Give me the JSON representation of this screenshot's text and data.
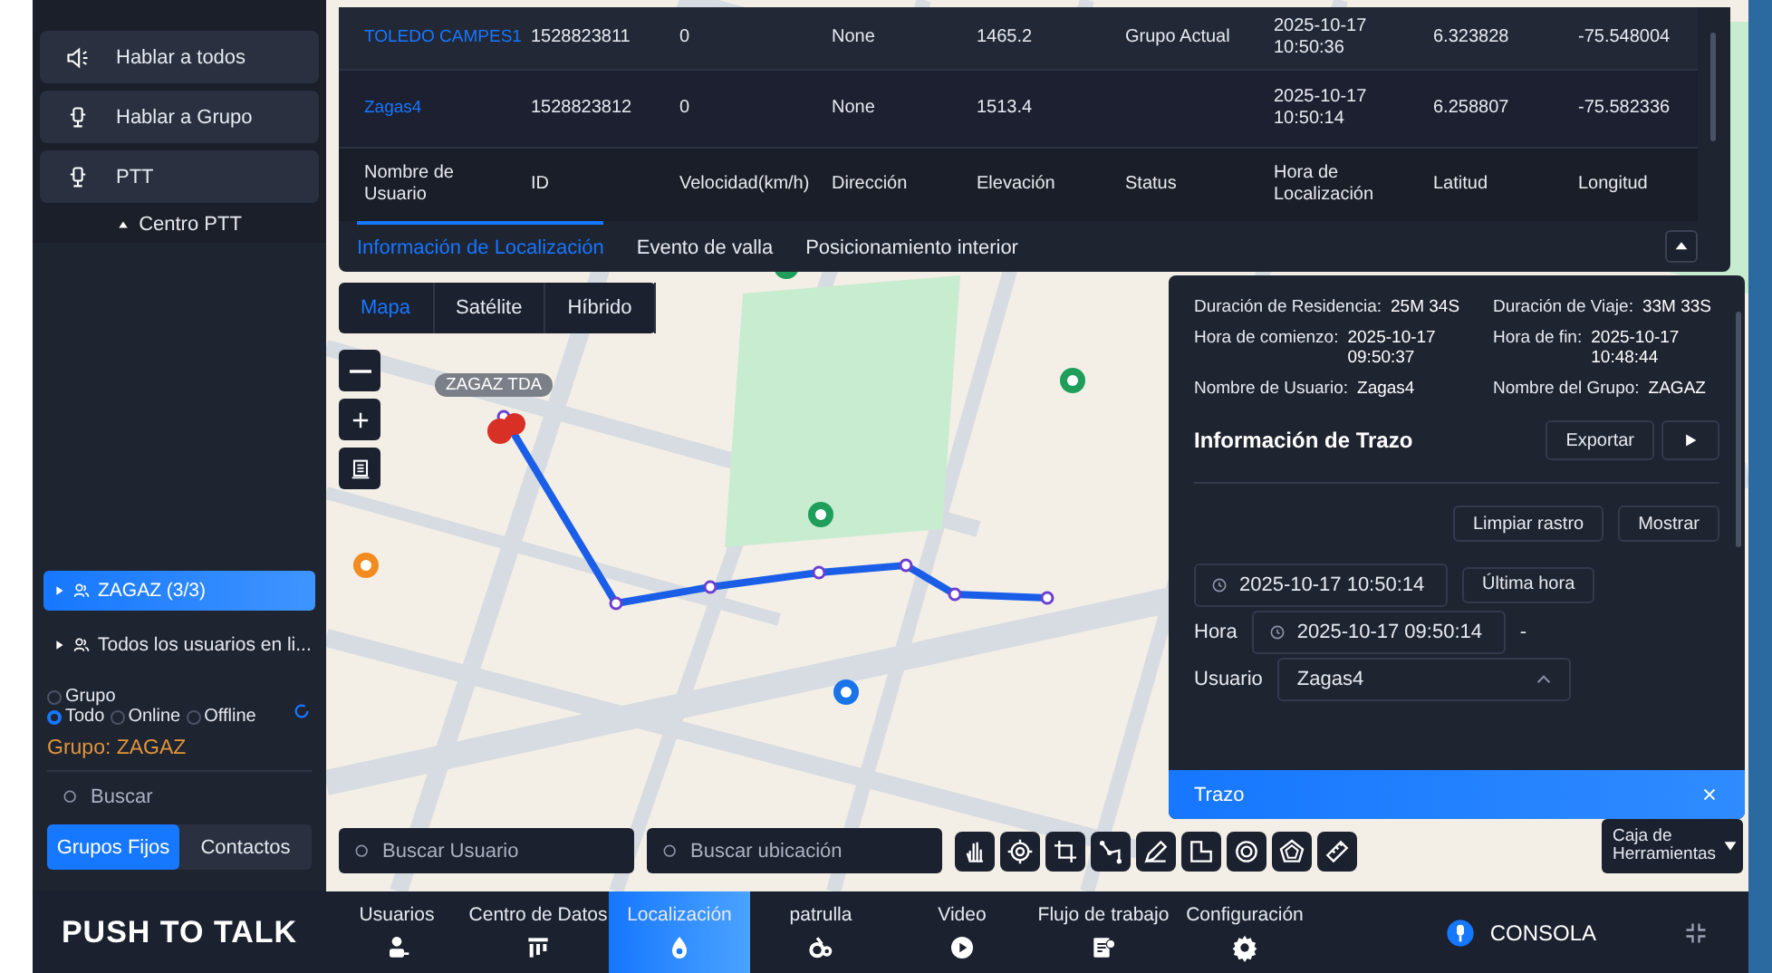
{
  "header": {
    "logo": "PUSH TO TALK",
    "nav": [
      {
        "label": "Usuarios",
        "selected": false
      },
      {
        "label": "Centro de Datos",
        "selected": false
      },
      {
        "label": "Localización",
        "selected": true
      },
      {
        "label": "patrulla",
        "selected": false
      },
      {
        "label": "Video",
        "selected": false
      },
      {
        "label": "Flujo de trabajo",
        "selected": false
      },
      {
        "label": "Configuración",
        "selected": false
      }
    ],
    "console": "CONSOLA"
  },
  "sidebar": {
    "ptt_buttons": [
      "Hablar a todos",
      "Hablar a Grupo",
      "PTT"
    ],
    "ptt_center": "Centro PTT",
    "tree": [
      {
        "label": "ZAGAZ (3/3)",
        "selected": true
      },
      {
        "label": "Todos los usuarios en li...",
        "selected": false
      }
    ],
    "filters": [
      {
        "label": "Grupo",
        "selected": false
      },
      {
        "label": "Todo",
        "selected": true
      },
      {
        "label": "Online",
        "selected": false
      },
      {
        "label": "Offline",
        "selected": false
      }
    ],
    "group_label": "Grupo: ZAGAZ",
    "search": {
      "placeholder": "Buscar"
    },
    "tabs": [
      {
        "label": "Grupos Fijos",
        "selected": true
      },
      {
        "label": "Contactos",
        "selected": false
      }
    ]
  },
  "location_panel": {
    "table_rows": [
      {
        "kind": "data",
        "cells": [
          "TOLEDO CAMPES1",
          "1528823811",
          "0",
          "None",
          "1465.2",
          "Grupo Actual",
          "2025-10-17 10:50:36",
          "6.323828",
          "-75.548004"
        ]
      },
      {
        "kind": "data",
        "cells": [
          "Zagas4",
          "1528823812",
          "0",
          "None",
          "1513.4",
          null,
          "2025-10-17 10:50:14",
          "6.258807",
          "-75.582336"
        ]
      },
      {
        "kind": "header",
        "cells": [
          "Nombre de Usuario",
          "ID",
          "Velocidad(km/h)",
          "Dirección",
          "Elevación",
          "Status",
          "Hora de Localización",
          "Latitud",
          "Longitud"
        ]
      }
    ],
    "tabs": [
      {
        "label": "Información de Localización",
        "selected": true
      },
      {
        "label": "Evento de valla",
        "selected": false
      },
      {
        "label": "Posicionamiento interior",
        "selected": false
      }
    ]
  },
  "map": {
    "map_types": [
      {
        "label": "Mapa",
        "selected": true
      },
      {
        "label": "Satélite",
        "selected": false
      },
      {
        "label": "Híbrido",
        "selected": false
      }
    ],
    "marker_label": "ZAGAZ TDA",
    "search_user": {
      "placeholder": "Buscar Usuario"
    },
    "search_place": {
      "placeholder": "Buscar ubicación"
    },
    "toolbox": "Caja de Herramientas"
  },
  "trace_panel": {
    "details": [
      {
        "label": "Duración de Residencia:",
        "value": "25M 34S"
      },
      {
        "label": "Duración de Viaje:",
        "value": "33M 33S"
      },
      {
        "label": "Hora de comienzo:",
        "value": "2025-10-17 09:50:37"
      },
      {
        "label": "Hora de fin:",
        "value": "2025-10-17 10:48:44"
      },
      {
        "label": "Nombre de Usuario:",
        "value": "Zagas4"
      },
      {
        "label": "Nombre del Grupo:",
        "value": "ZAGAZ"
      }
    ],
    "info_title": "Información de Trazo",
    "export": "Exportar",
    "clear": "Limpiar rastro",
    "show": "Mostrar",
    "end": "2025-10-17 10:50:14",
    "last_hour": "Última hora",
    "time_label": "Hora",
    "start": "2025-10-17 09:50:14",
    "separator": "-",
    "user_label": "Usuario",
    "user_value": "Zagas4",
    "title": "Trazo"
  }
}
